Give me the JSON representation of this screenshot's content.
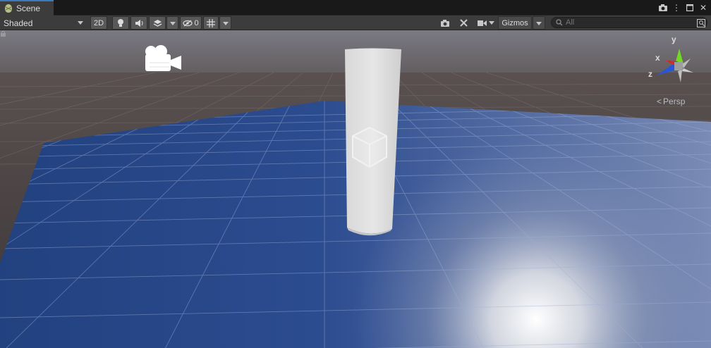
{
  "tab": {
    "title": "Scene"
  },
  "toolbar": {
    "draw_mode": "Shaded",
    "mode_2d": "2D",
    "hidden_count": "0",
    "gizmos_label": "Gizmos",
    "search_placeholder": "All"
  },
  "gizmo": {
    "axis_x": "x",
    "axis_y": "y",
    "axis_z": "z",
    "projection": "Persp",
    "colors": {
      "x": "#d9262a",
      "y": "#74d923",
      "z": "#2a55d9"
    }
  },
  "scene": {
    "sky_color": "#5e5d62",
    "ground_color": "#2a4a8d",
    "object_color": "#dcdcdc"
  }
}
